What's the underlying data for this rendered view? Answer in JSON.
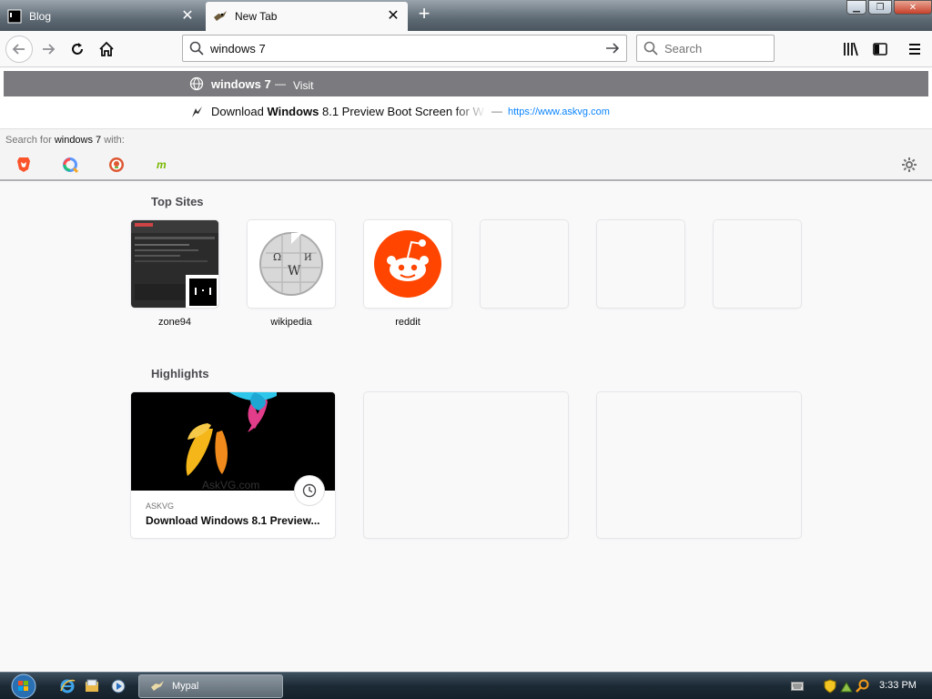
{
  "tabs": [
    {
      "label": "Blog",
      "favicon": "terminal-icon",
      "active": false
    },
    {
      "label": "New Tab",
      "favicon": "bird-icon",
      "active": true
    }
  ],
  "urlbar": {
    "value": "windows 7"
  },
  "searchbar": {
    "placeholder": "Search"
  },
  "popup": {
    "visit_row": {
      "title": "windows 7",
      "separator": "—",
      "action": "Visit"
    },
    "result_row": {
      "title_prefix": "Download ",
      "title_bold": "Windows",
      "title_suffix": " 8.1 Preview Boot Screen for W",
      "separator": "—",
      "url": "https://www.askvg.com"
    },
    "oneoff": {
      "prefix": "Search for ",
      "query": "windows 7",
      "suffix": " with:",
      "engines": [
        "brave-icon",
        "qwant-icon",
        "duckduckgo-icon",
        "mojeek-icon"
      ]
    }
  },
  "top_sites": {
    "title": "Top Sites",
    "items": [
      {
        "label": "zone94",
        "icon": "zone94-screenshot"
      },
      {
        "label": "wikipedia",
        "icon": "wikipedia-globe-icon"
      },
      {
        "label": "reddit",
        "icon": "reddit-icon"
      }
    ],
    "empty_slots": 3
  },
  "highlights": {
    "title": "Highlights",
    "card": {
      "source": "ASKVG",
      "title": "Download Windows 8.1 Preview...",
      "watermark": "AskVG.com"
    },
    "empty_slots": 2
  },
  "taskbar": {
    "task_label": "Mypal",
    "time": "3:33 PM"
  },
  "colors": {
    "accent": "#0a84ff",
    "reddit": "#ff4500",
    "visit_row": "#7b7b7f"
  }
}
